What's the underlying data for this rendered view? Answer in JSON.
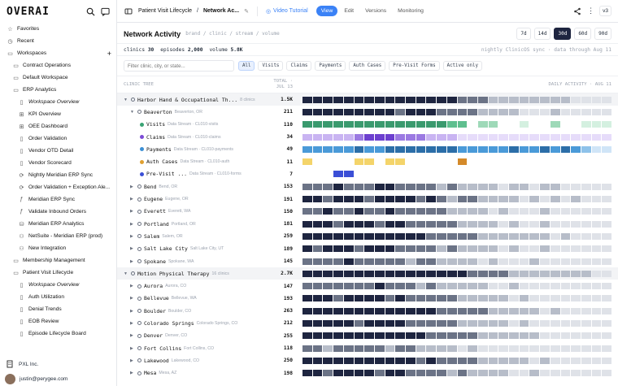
{
  "sidebar": {
    "logo": "OVERAI",
    "items": [
      {
        "label": "Favorites",
        "icon": "star-icon",
        "glyph": "☆",
        "indent": 0,
        "italic": false
      },
      {
        "label": "Recent",
        "icon": "clock-icon",
        "glyph": "◷",
        "indent": 0,
        "italic": false
      },
      {
        "label": "Workspaces",
        "icon": "folder-icon",
        "glyph": "▭",
        "indent": 0,
        "italic": false,
        "plus": "+"
      },
      {
        "label": "Contract Operations",
        "icon": "folder-icon",
        "glyph": "▭",
        "indent": 1,
        "italic": false
      },
      {
        "label": "Default Workspace",
        "icon": "folder-icon",
        "glyph": "▭",
        "indent": 1,
        "italic": false
      },
      {
        "label": "ERP Analytics",
        "icon": "folder-icon",
        "glyph": "▭",
        "indent": 1,
        "italic": false
      },
      {
        "label": "Workspace Overview",
        "icon": "doc-icon",
        "glyph": "▯",
        "indent": 2,
        "italic": true
      },
      {
        "label": "KPI Overview",
        "icon": "grid-icon",
        "glyph": "⊞",
        "indent": 2,
        "italic": false
      },
      {
        "label": "OEE Dashboard",
        "icon": "grid-icon",
        "glyph": "⊞",
        "indent": 2,
        "italic": false
      },
      {
        "label": "Order Validation",
        "icon": "doc-icon",
        "glyph": "▯",
        "indent": 2,
        "italic": false
      },
      {
        "label": "Vendor OTD Detail",
        "icon": "doc-icon",
        "glyph": "▯",
        "indent": 2,
        "italic": false
      },
      {
        "label": "Vendor Scorecard",
        "icon": "doc-icon",
        "glyph": "▯",
        "indent": 2,
        "italic": false
      },
      {
        "label": "Nightly Meridian ERP Sync",
        "icon": "sync-icon",
        "glyph": "⟳",
        "indent": 2,
        "italic": false
      },
      {
        "label": "Order Validation + Exception Ale...",
        "icon": "sync-icon",
        "glyph": "⟳",
        "indent": 2,
        "italic": false
      },
      {
        "label": "Meridian ERP Sync",
        "icon": "function-icon",
        "glyph": "ƒ",
        "indent": 2,
        "italic": false
      },
      {
        "label": "Validate Inbound Orders",
        "icon": "function-icon",
        "glyph": "ƒ",
        "indent": 2,
        "italic": false
      },
      {
        "label": "Meridian ERP Analytics",
        "icon": "database-icon",
        "glyph": "⛁",
        "indent": 2,
        "italic": false
      },
      {
        "label": "NetSuite - Meridian ERP (prod)",
        "icon": "plug-icon",
        "glyph": "⚇",
        "indent": 2,
        "italic": false
      },
      {
        "label": "New Integration",
        "icon": "plug-icon",
        "glyph": "⚇",
        "indent": 2,
        "italic": false
      },
      {
        "label": "Membership Management",
        "icon": "folder-icon",
        "glyph": "▭",
        "indent": 1,
        "italic": false
      },
      {
        "label": "Patient Visit Lifecycle",
        "icon": "folder-icon",
        "glyph": "▭",
        "indent": 1,
        "italic": false
      },
      {
        "label": "Workspace Overview",
        "icon": "doc-icon",
        "glyph": "▯",
        "indent": 2,
        "italic": true
      },
      {
        "label": "Auth Utilization",
        "icon": "doc-icon",
        "glyph": "▯",
        "indent": 2,
        "italic": false
      },
      {
        "label": "Denial Trends",
        "icon": "doc-icon",
        "glyph": "▯",
        "indent": 2,
        "italic": false
      },
      {
        "label": "EOB Review",
        "icon": "doc-icon",
        "glyph": "▯",
        "indent": 2,
        "italic": false
      },
      {
        "label": "Episode Lifecycle Board",
        "icon": "doc-icon",
        "glyph": "▯",
        "indent": 2,
        "italic": false
      }
    ],
    "org": "PXL Inc.",
    "user": "justin@perygee.com"
  },
  "topbar": {
    "crumb1": "Patient Visit Lifecycle",
    "crumb2": "Network Ac...",
    "tutorial": "Video Tutorial",
    "tabs": [
      "View",
      "Edit",
      "Versions",
      "Monitoring"
    ],
    "active_tab": "View",
    "version": "v3"
  },
  "header": {
    "title": "Network Activity",
    "path": "brand / clinic / stream / volume",
    "ranges": [
      "7d",
      "14d",
      "30d",
      "60d",
      "90d"
    ],
    "selected_range": "30d"
  },
  "stats": {
    "clinics_label": "clinics",
    "clinics": "30",
    "episodes_label": "episodes",
    "episodes": "2,000",
    "volume_label": "volume",
    "volume": "5.8K",
    "sync": "nightly ClinicOS sync · data through Aug 11"
  },
  "filters": {
    "placeholder": "Filter clinic, city, or state...",
    "chips": [
      "All",
      "Visits",
      "Claims",
      "Payments",
      "Auth Cases",
      "Pre-Visit Forms",
      "Active only"
    ],
    "selected": "All"
  },
  "grid": {
    "col_tree": "CLINIC TREE",
    "col_total_1": "TOTAL ·",
    "col_total_2": "JUL 13",
    "col_daily": "DAILY ACTIVITY · AUG 11",
    "rows": [
      {
        "kind": "brand",
        "name": "Harbor Hand & Occupational Th...",
        "sub": "8 clinics",
        "total": "1.5K",
        "expanded": true,
        "pal": "gray",
        "cells": [
          4,
          4,
          4,
          4,
          4,
          4,
          4,
          4,
          4,
          4,
          4,
          4,
          4,
          4,
          4,
          3,
          3,
          3,
          2,
          2,
          2,
          2,
          2,
          2,
          2,
          2,
          1,
          1,
          1,
          1
        ]
      },
      {
        "kind": "clinic",
        "name": "Beaverton",
        "sub": "Beaverton, OR",
        "total": "211",
        "expanded": true,
        "pal": "gray",
        "cells": [
          4,
          4,
          4,
          4,
          4,
          4,
          4,
          4,
          4,
          3,
          4,
          4,
          4,
          3,
          3,
          3,
          3,
          2,
          2,
          2,
          2,
          1,
          1,
          1,
          2,
          1,
          1,
          1,
          1,
          1
        ]
      },
      {
        "kind": "stream",
        "name": "Visits",
        "sub": "Data Stream · CL010-visits",
        "total": "110",
        "dot": "#3aa374",
        "pal": "green",
        "cells": [
          4,
          4,
          4,
          4,
          4,
          4,
          4,
          4,
          4,
          4,
          4,
          4,
          4,
          4,
          3,
          3,
          0,
          2,
          2,
          0,
          0,
          1,
          0,
          0,
          2,
          0,
          0,
          1,
          1,
          1
        ]
      },
      {
        "kind": "stream",
        "name": "Claims",
        "sub": "Data Stream · CL010-claims",
        "total": "34",
        "dot": "#7c4bd6",
        "pal": "purple",
        "cells": [
          2,
          2,
          2,
          2,
          2,
          3,
          4,
          4,
          4,
          3,
          3,
          3,
          2,
          2,
          2,
          1,
          1,
          1,
          1,
          1,
          1,
          1,
          1,
          1,
          1,
          1,
          1,
          1,
          1,
          1
        ]
      },
      {
        "kind": "stream",
        "name": "Payments",
        "sub": "Data Stream · CL010-payments",
        "total": "49",
        "dot": "#3b8fd4",
        "pal": "blue",
        "cells": [
          3,
          3,
          3,
          3,
          3,
          4,
          3,
          3,
          4,
          4,
          4,
          4,
          4,
          4,
          4,
          3,
          3,
          3,
          3,
          3,
          4,
          3,
          3,
          4,
          3,
          4,
          3,
          2,
          1,
          1
        ]
      },
      {
        "kind": "stream",
        "name": "Auth Cases",
        "sub": "Data Stream · CL010-auth",
        "total": "11",
        "dot": "#e0a030",
        "pal": "amber",
        "cells": [
          2,
          0,
          0,
          0,
          0,
          2,
          2,
          0,
          2,
          2,
          0,
          0,
          0,
          0,
          0,
          4,
          0,
          0,
          0,
          0,
          0,
          0,
          0,
          0,
          0,
          0,
          0,
          0,
          0,
          0
        ]
      },
      {
        "kind": "stream",
        "name": "Pre-Visit ...",
        "sub": "Data Stream · CL010-forms",
        "total": "7",
        "dot": "#3b4fd6",
        "pal": "indigo",
        "cells": [
          0,
          0,
          0,
          4,
          4,
          0,
          0,
          0,
          0,
          0,
          0,
          0,
          0,
          0,
          0,
          0,
          0,
          0,
          0,
          0,
          0,
          0,
          0,
          0,
          0,
          0,
          0,
          0,
          0,
          0
        ]
      },
      {
        "kind": "clinic",
        "name": "Bend",
        "sub": "Bend, OR",
        "total": "153",
        "pal": "gray",
        "cells": [
          3,
          3,
          3,
          4,
          3,
          3,
          3,
          4,
          4,
          3,
          3,
          3,
          3,
          2,
          3,
          2,
          2,
          2,
          2,
          1,
          2,
          2,
          1,
          2,
          2,
          1,
          1,
          1,
          1,
          1
        ]
      },
      {
        "kind": "clinic",
        "name": "Eugene",
        "sub": "Eugene, OR",
        "total": "191",
        "pal": "gray",
        "cells": [
          4,
          4,
          3,
          4,
          4,
          4,
          3,
          4,
          4,
          4,
          4,
          3,
          4,
          3,
          2,
          3,
          3,
          2,
          2,
          2,
          2,
          1,
          2,
          1,
          2,
          1,
          2,
          1,
          1,
          1
        ]
      },
      {
        "kind": "clinic",
        "name": "Everett",
        "sub": "Everett, WA",
        "total": "150",
        "pal": "gray",
        "cells": [
          3,
          3,
          4,
          3,
          3,
          4,
          3,
          3,
          4,
          3,
          3,
          3,
          3,
          3,
          2,
          2,
          2,
          2,
          1,
          2,
          1,
          1,
          1,
          2,
          1,
          1,
          1,
          1,
          1,
          1
        ]
      },
      {
        "kind": "clinic",
        "name": "Portland",
        "sub": "Portland, OR",
        "total": "181",
        "pal": "gray",
        "cells": [
          4,
          4,
          4,
          3,
          4,
          4,
          4,
          3,
          4,
          4,
          3,
          3,
          3,
          3,
          3,
          2,
          2,
          2,
          2,
          1,
          2,
          1,
          1,
          2,
          1,
          1,
          1,
          1,
          1,
          1
        ]
      },
      {
        "kind": "clinic",
        "name": "Salem",
        "sub": "Salem, OR",
        "total": "259",
        "pal": "gray",
        "cells": [
          4,
          4,
          4,
          4,
          4,
          4,
          4,
          4,
          4,
          4,
          4,
          4,
          3,
          3,
          3,
          3,
          3,
          2,
          2,
          2,
          2,
          2,
          2,
          2,
          1,
          2,
          1,
          1,
          1,
          1
        ]
      },
      {
        "kind": "clinic",
        "name": "Salt Lake City",
        "sub": "Salt Lake City, UT",
        "total": "189",
        "pal": "gray",
        "cells": [
          4,
          3,
          4,
          4,
          4,
          3,
          4,
          4,
          4,
          3,
          3,
          3,
          3,
          2,
          3,
          2,
          2,
          2,
          2,
          1,
          2,
          1,
          1,
          2,
          1,
          1,
          1,
          1,
          1,
          1
        ]
      },
      {
        "kind": "clinic",
        "name": "Spokane",
        "sub": "Spokane, WA",
        "total": "145",
        "pal": "gray",
        "cells": [
          3,
          3,
          3,
          3,
          4,
          3,
          3,
          3,
          3,
          3,
          2,
          3,
          3,
          2,
          2,
          2,
          2,
          1,
          2,
          1,
          1,
          1,
          2,
          1,
          1,
          1,
          1,
          1,
          1,
          1
        ]
      },
      {
        "kind": "brand",
        "name": "Motion Physical Therapy",
        "sub": "16 clinics",
        "total": "2.7K",
        "expanded": true,
        "pal": "gray",
        "cells": [
          4,
          4,
          4,
          4,
          4,
          4,
          4,
          4,
          4,
          4,
          4,
          4,
          4,
          4,
          4,
          4,
          3,
          3,
          3,
          3,
          2,
          2,
          2,
          2,
          2,
          2,
          2,
          2,
          1,
          1
        ]
      },
      {
        "kind": "clinic",
        "name": "Aurora",
        "sub": "Aurora, CO",
        "total": "147",
        "pal": "gray",
        "cells": [
          3,
          3,
          3,
          3,
          3,
          3,
          3,
          4,
          3,
          3,
          3,
          2,
          3,
          2,
          2,
          2,
          2,
          2,
          1,
          1,
          2,
          1,
          1,
          1,
          1,
          1,
          1,
          1,
          1,
          1
        ]
      },
      {
        "kind": "clinic",
        "name": "Bellevue",
        "sub": "Bellevue, WA",
        "total": "193",
        "pal": "gray",
        "cells": [
          4,
          4,
          4,
          3,
          4,
          4,
          4,
          4,
          3,
          4,
          3,
          3,
          3,
          3,
          3,
          2,
          2,
          2,
          2,
          2,
          1,
          2,
          1,
          1,
          1,
          1,
          1,
          1,
          1,
          1
        ]
      },
      {
        "kind": "clinic",
        "name": "Boulder",
        "sub": "Boulder, CO",
        "total": "263",
        "pal": "gray",
        "cells": [
          4,
          4,
          4,
          4,
          4,
          4,
          4,
          4,
          4,
          4,
          4,
          4,
          4,
          3,
          3,
          3,
          3,
          3,
          2,
          2,
          2,
          2,
          2,
          1,
          2,
          1,
          1,
          1,
          1,
          1
        ]
      },
      {
        "kind": "clinic",
        "name": "Colorado Springs",
        "sub": "Colorado Springs, CO",
        "total": "212",
        "pal": "gray",
        "cells": [
          4,
          4,
          4,
          4,
          4,
          3,
          4,
          4,
          4,
          4,
          3,
          3,
          3,
          3,
          3,
          2,
          2,
          2,
          2,
          2,
          1,
          2,
          1,
          1,
          1,
          1,
          1,
          1,
          1,
          1
        ]
      },
      {
        "kind": "clinic",
        "name": "Denver",
        "sub": "Denver, CO",
        "total": "255",
        "pal": "gray",
        "cells": [
          4,
          4,
          4,
          4,
          4,
          4,
          4,
          4,
          4,
          4,
          4,
          4,
          3,
          3,
          3,
          3,
          3,
          2,
          2,
          2,
          2,
          2,
          2,
          1,
          1,
          1,
          1,
          1,
          1,
          1
        ]
      },
      {
        "kind": "clinic",
        "name": "Fort Collins",
        "sub": "Fort Collins, CO",
        "total": "118",
        "pal": "gray",
        "cells": [
          3,
          3,
          2,
          3,
          3,
          3,
          3,
          3,
          2,
          3,
          3,
          2,
          2,
          2,
          2,
          1,
          2,
          1,
          1,
          1,
          1,
          1,
          1,
          1,
          1,
          1,
          1,
          1,
          1,
          1
        ]
      },
      {
        "kind": "clinic",
        "name": "Lakewood",
        "sub": "Lakewood, CO",
        "total": "250",
        "pal": "gray",
        "cells": [
          4,
          4,
          4,
          4,
          4,
          4,
          4,
          4,
          4,
          4,
          4,
          3,
          4,
          3,
          3,
          3,
          3,
          2,
          2,
          2,
          2,
          2,
          1,
          2,
          1,
          1,
          1,
          1,
          1,
          1
        ]
      },
      {
        "kind": "clinic",
        "name": "Mesa",
        "sub": "Mesa, AZ",
        "total": "198",
        "pal": "gray",
        "cells": [
          4,
          4,
          3,
          4,
          4,
          4,
          4,
          3,
          4,
          4,
          3,
          3,
          3,
          3,
          2,
          3,
          2,
          2,
          2,
          2,
          1,
          1,
          2,
          1,
          1,
          1,
          1,
          1,
          1,
          1
        ]
      }
    ]
  },
  "palettes": {
    "gray": [
      "#ffffff",
      "#dfe2e8",
      "#b7bdc9",
      "#6b7386",
      "#1e2540"
    ],
    "green": [
      "#ffffff",
      "#d4f0e0",
      "#9ed9b8",
      "#5fbf8f",
      "#3a9a6e"
    ],
    "purple": [
      "#ffffff",
      "#e6dcfa",
      "#c9b4f2",
      "#9b79e2",
      "#6c3fcf"
    ],
    "blue": [
      "#ffffff",
      "#d0e5f7",
      "#8ec2ea",
      "#4a9ad8",
      "#2c6ea8"
    ],
    "amber": [
      "#ffffff",
      "#fbeec0",
      "#f4d46a",
      "#e7b43a",
      "#d48a2a"
    ],
    "indigo": [
      "#ffffff",
      "#dde0fb",
      "#a9b1f2",
      "#6b79e4",
      "#3b4fd6"
    ]
  }
}
